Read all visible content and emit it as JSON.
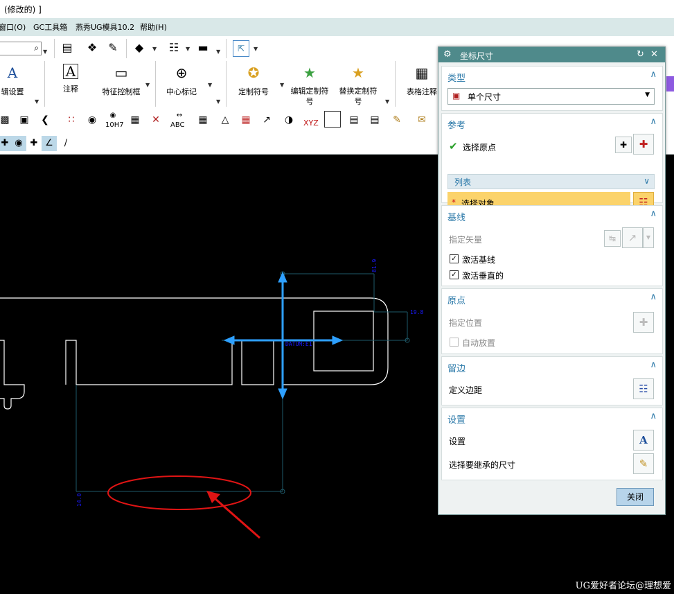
{
  "title": "(修改的) ]",
  "menu": [
    "窗口(O)",
    "GC工具箱",
    "燕秀UG模具10.2",
    "帮助(H)"
  ],
  "toolbar": {
    "big_buttons": [
      {
        "label": "辑设置",
        "icon": "text-style-icon"
      },
      {
        "label": "注释",
        "icon": "annotation-icon"
      },
      {
        "label": "特征控制框",
        "icon": "feature-control-frame-icon"
      },
      {
        "label": "中心标记",
        "icon": "center-mark-icon"
      },
      {
        "label": "定制符号",
        "icon": "custom-symbol-icon"
      },
      {
        "label": "编辑定制符号",
        "icon": "edit-custom-symbol-icon"
      },
      {
        "label": "替换定制符号",
        "icon": "replace-custom-symbol-icon"
      },
      {
        "label": "表格注释",
        "icon": "table-note-icon"
      }
    ],
    "row3_labels": [
      "10H7",
      "ABC",
      "XYZ"
    ]
  },
  "canvas": {
    "dim_labels": [
      "81.9",
      "19.8",
      "DATUM:E1",
      "14.0"
    ],
    "colors": {
      "geometry": "#ffffff",
      "dimension": "#1a1aff",
      "handle": "#2ea0ff",
      "ellipse": "#e01414"
    }
  },
  "watermark": "UG爱好者论坛@理想爱",
  "dialog": {
    "title": "坐标尺寸",
    "type": {
      "header": "类型",
      "value": "单个尺寸"
    },
    "reference": {
      "header": "参考",
      "select_origin": "选择原点",
      "list": "列表",
      "select_object": "选择对象",
      "required_mark": "*"
    },
    "baseline": {
      "header": "基线",
      "specify_vector": "指定矢量",
      "activate_baseline": "激活基线",
      "activate_perpendicular": "激活垂直的"
    },
    "origin": {
      "header": "原点",
      "specify_position": "指定位置",
      "auto_place": "自动放置"
    },
    "margin": {
      "header": "留边",
      "define_margin": "定义边距"
    },
    "settings": {
      "header": "设置",
      "settings_label": "设置",
      "inherit_label": "选择要继承的尺寸"
    },
    "close_label": "关闭"
  }
}
